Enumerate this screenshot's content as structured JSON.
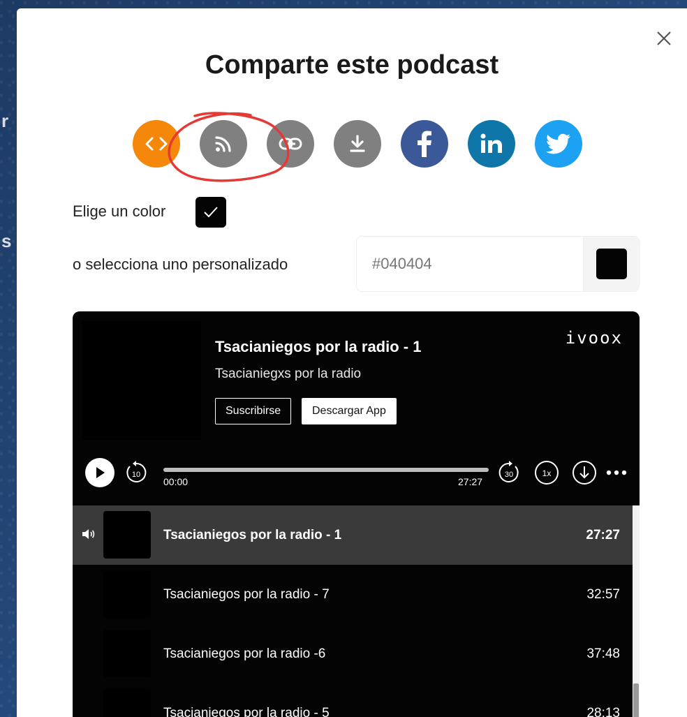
{
  "background": {
    "text_fragments": [
      "r",
      "s"
    ]
  },
  "modal": {
    "title": "Comparte este podcast",
    "share_buttons": [
      {
        "name": "embed-icon",
        "color": "#f5870a"
      },
      {
        "name": "rss-icon",
        "color": "#808080"
      },
      {
        "name": "link-icon",
        "color": "#808080"
      },
      {
        "name": "download-icon",
        "color": "#808080"
      },
      {
        "name": "facebook-icon",
        "color": "#3b5998"
      },
      {
        "name": "linkedin-icon",
        "color": "#0e76a8"
      },
      {
        "name": "twitter-icon",
        "color": "#1da1f2"
      }
    ],
    "annotation_color": "#e53935",
    "color_label": "Elige un color",
    "custom_label": "o selecciona uno personalizado",
    "color_value": "#040404",
    "swatch_color": "#040404"
  },
  "player": {
    "brand": "ivoox",
    "episode_title": "Tsacianiegos por la radio - 1",
    "podcast_name": "Tsacianiegxs por la radio",
    "subscribe_label": "Suscribirse",
    "app_label": "Descargar App",
    "time_current": "00:00",
    "time_total": "27:27",
    "progress": 0,
    "rewind_label": "10",
    "forward_label": "30",
    "speed_label": "1x",
    "playlist": [
      {
        "title": "Tsacianiegos por la radio - 1",
        "duration": "27:27",
        "active": true
      },
      {
        "title": "Tsacianiegos por la radio - 7",
        "duration": "32:57",
        "active": false
      },
      {
        "title": "Tsacianiegos por la radio -6",
        "duration": "37:48",
        "active": false
      },
      {
        "title": "Tsacianiegos por la radio - 5",
        "duration": "28:13",
        "active": false
      }
    ]
  }
}
